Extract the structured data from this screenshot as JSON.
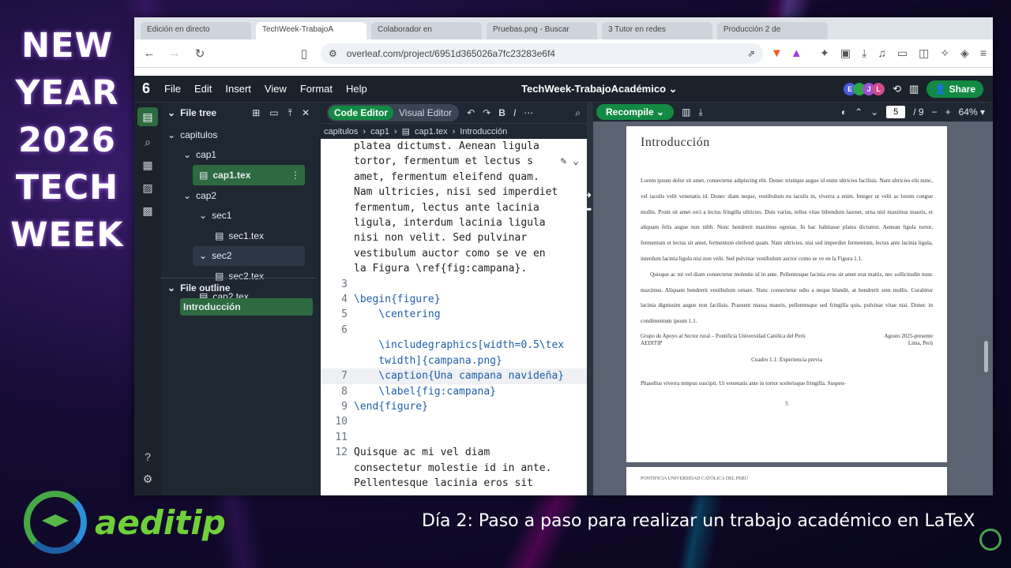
{
  "overlay": {
    "banner_lines": [
      "NEW",
      "YEAR",
      "2026",
      "TECH",
      "WEEK"
    ],
    "logo_text": "aeditip",
    "footer_title": "Día 2: Paso a paso para realizar un trabajo académico en LaTeX"
  },
  "browser": {
    "tabs": [
      "Edición en directo",
      "TechWeek-TrabajoA",
      "Colaborador en",
      "Pruebas.png - Buscar",
      "3 Tutor en redes",
      "Producción 2 de"
    ],
    "url": "overleaf.com/project/6951d365026a7fc23283e6f4"
  },
  "app": {
    "menu": [
      "File",
      "Edit",
      "Insert",
      "View",
      "Format",
      "Help"
    ],
    "project_title": "TechWeek-TrabajoAcadémico",
    "share_label": "Share",
    "avatars": [
      {
        "initial": "E",
        "color": "#4a5bd8"
      },
      {
        "initial": "",
        "color": "#2aa84a"
      },
      {
        "initial": "J",
        "color": "#9b4fd1"
      },
      {
        "initial": "L",
        "color": "#d04a8a"
      }
    ]
  },
  "filetree": {
    "title": "File tree",
    "items": [
      {
        "label": "capitulos",
        "level": 0,
        "type": "folder"
      },
      {
        "label": "cap1",
        "level": 1,
        "type": "folder"
      },
      {
        "label": "cap1.tex",
        "level": 2,
        "type": "file",
        "state": "selected"
      },
      {
        "label": "cap2",
        "level": 1,
        "type": "folder"
      },
      {
        "label": "sec1",
        "level": 2,
        "type": "folder"
      },
      {
        "label": "sec1.tex",
        "level": 3,
        "type": "file"
      },
      {
        "label": "sec2",
        "level": 2,
        "type": "folder",
        "state": "hover"
      },
      {
        "label": "sec2.tex",
        "level": 3,
        "type": "file"
      },
      {
        "label": "cap2.tex",
        "level": 2,
        "type": "file"
      }
    ],
    "outline_title": "File outline",
    "outline_item": "Introducción"
  },
  "editor": {
    "code_editor_label": "Code Editor",
    "visual_editor_label": "Visual Editor",
    "breadcrumbs": [
      "capitulos",
      "cap1",
      "cap1.tex",
      "Introducción"
    ],
    "lines": [
      {
        "n": "",
        "text": "platea dictumst. Aenean ligula"
      },
      {
        "n": "",
        "text": "tortor, fermentum et lectus s"
      },
      {
        "n": "",
        "text": "amet, fermentum eleifend quam."
      },
      {
        "n": "",
        "text": "Nam ultricies, nisi sed imperdiet"
      },
      {
        "n": "",
        "text": "fermentum, lectus ante lacinia"
      },
      {
        "n": "",
        "text": "ligula, interdum lacinia ligula"
      },
      {
        "n": "",
        "text": "nisi non velit. Sed pulvinar"
      },
      {
        "n": "",
        "text": "vestibulum auctor como se ve en"
      },
      {
        "n": "",
        "text": "la Figura \\ref{fig:campana}."
      },
      {
        "n": "3",
        "text": ""
      },
      {
        "n": "4",
        "text": "\\begin{figure}"
      },
      {
        "n": "5",
        "text": "    \\centering"
      },
      {
        "n": "6",
        "text": ""
      },
      {
        "n": "",
        "text": "    \\includegraphics[width=0.5\\tex"
      },
      {
        "n": "",
        "text": "    twidth]{campana.png}"
      },
      {
        "n": "7",
        "text": "    \\caption{Una campana navideña}"
      },
      {
        "n": "8",
        "text": "    \\label{fig:campana}"
      },
      {
        "n": "9",
        "text": "\\end{figure}"
      },
      {
        "n": "10",
        "text": ""
      },
      {
        "n": "11",
        "text": ""
      },
      {
        "n": "12",
        "text": "Quisque ac mi vel diam"
      },
      {
        "n": "",
        "text": "consectetur molestie id in ante."
      },
      {
        "n": "",
        "text": "Pellentesque lacinia eros sit"
      }
    ]
  },
  "pdf": {
    "recompile_label": "Recompile",
    "page_current": "5",
    "page_total": "/ 9",
    "zoom": "64%",
    "heading": "Introducción",
    "para1": "Lorem ipsum dolor sit amet, consectetur adipiscing elit. Donec tristique augue id enim ultricies facilisis. Nam ultricies elit nunc, vel iaculis velit venenatis id. Donec diam neque, vestibulum eu iaculis in, viverra a enim. Integer ut velit ac lorem congue mollis. Proin sit amet orci a lectus fringilla ultricies. Duis varius, tellus vitae bibendum laoreet, urna nisl maximus mauris, et aliquam felis augue non nibh. Nunc hendrerit maximus egestas. In hac habitasse platea dictumst. Aenean ligula tortor, fermentum et lectus sit amet, fermentum eleifend quam. Nam ultricies, nisi sed imperdiet fermentum, lectus ante lacinia ligula, interdum lacinia ligula nisi non velit. Sed pulvinar vestibulum auctor como se ve en la Figura 1.1.",
    "para2": "Quisque ac mi vel diam consectetur molestie id in ante. Pellentesque lacinia eros sit amet erat mattis, nec sollicitudin nunc maximus. Aliquam hendrerit vestibulum ornare. Nunc consectetur odio a neque blandit, at hendrerit sem mollis. Curabitur lacinia dignissim augue non facilisis. Praesent massa mauris, pellentesque sed fringilla quis, pulvinar vitae nisi. Donec in condimentum ipsum 1.1.",
    "table_left": "Grupo de Apoyo al Sector rural – Pontificia Universidad Católica del Perú\nAEDITIP",
    "table_right": "Agosto 2025-presente\nLima, Perú",
    "table_caption": "Cuadro 1.1: Experiencia previa",
    "para3": "Phasellus viverra tempus suscipit. Ut venenatis ante in tortor scelerisque fringilla. Suspen-",
    "page_number": "5",
    "next_page_header": "PONTIFICIA UNIVERSIDAD CATÓLICA DEL PERÚ"
  }
}
